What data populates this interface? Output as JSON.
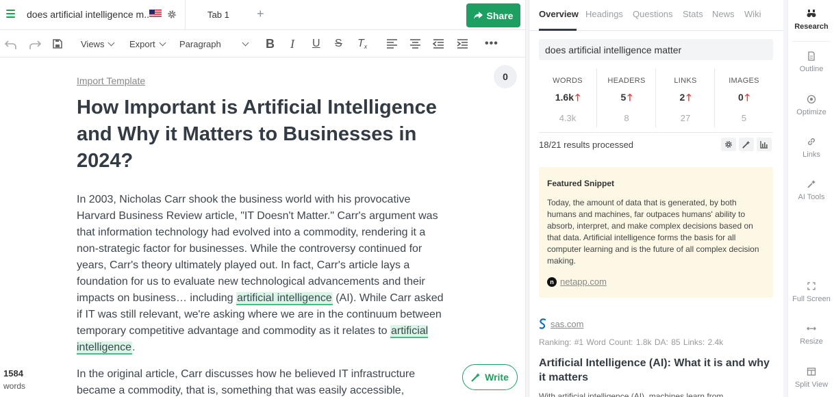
{
  "header": {
    "doc_title": "does artificial intelligence m...",
    "tab_label": "Tab 1",
    "add_tab": "+",
    "share_label": "Share"
  },
  "toolbar": {
    "views_label": "Views",
    "export_label": "Export",
    "block_type": "Paragraph"
  },
  "editor": {
    "import_template": "Import Template",
    "comment_count": "0",
    "heading": "How Important is Artificial Intelligence and Why it Matters to Businesses in 2024?",
    "para1_a": "In 2003, Nicholas Carr shook the business world with his provocative Harvard Business Review article, \"IT Doesn't Matter.\" Carr's argument was that information technology had evolved into a commodity, rendering it a non-strategic factor for businesses. While the controversy continued for years, Carr's theory ultimately played out. In fact, Carr's article lays a foundation for us to evaluate new technological advancements and their impacts on business… including ",
    "para1_hl1": "artificial intelligence",
    "para1_b": " (AI). While Carr asked if IT was still relevant, we're asking where we are in the continuum between temporary competitive advantage and commodity as it relates to ",
    "para1_hl2": "artificial intelligence",
    "para1_c": ".",
    "para2": "In the original article, Carr discusses how he believed IT infrastructure became a commodity, that is, something that was easily accessible,",
    "word_count": "1584",
    "word_label": "words",
    "write_label": "Write"
  },
  "panel": {
    "tabs": [
      "Overview",
      "Headings",
      "Questions",
      "Stats",
      "News",
      "Wiki"
    ],
    "query": "does artificial intelligence matter",
    "stats": [
      {
        "label": "WORDS",
        "value": "1.6k",
        "target": "4.3k"
      },
      {
        "label": "HEADERS",
        "value": "5",
        "target": "8"
      },
      {
        "label": "LINKS",
        "value": "2",
        "target": "27"
      },
      {
        "label": "IMAGES",
        "value": "0",
        "target": "5"
      }
    ],
    "up_arrow": "🡑",
    "processed": "18/21 results processed",
    "snippet": {
      "heading": "Featured Snippet",
      "text": "Today, the amount of data that is generated, by both humans and machines, far outpaces humans' ability to absorb, interpret, and make complex decisions based on that data. Artificial intelligence forms the basis for all computer learning and is the future of all complex decision making.",
      "source": "netapp.com",
      "source_icon": "n"
    },
    "result": {
      "source": "sas.com",
      "ranking": "Ranking: #1  Word Count: 1.8k  DA: 85  Links: 2.4k",
      "title": "Artificial Intelligence (AI): What it is and why it matters",
      "snippet": "With artificial intelligence (AI), machines learn from"
    }
  },
  "rail": {
    "items": [
      {
        "label": "Research",
        "icon": "binoculars-icon"
      },
      {
        "label": "Outline",
        "icon": "document-icon"
      },
      {
        "label": "Optimize",
        "icon": "target-icon"
      },
      {
        "label": "Links",
        "icon": "link-icon"
      },
      {
        "label": "AI Tools",
        "icon": "magic-wand-icon"
      },
      {
        "label": "Full Screen",
        "icon": "fullscreen-icon"
      },
      {
        "label": "Resize",
        "icon": "resize-icon"
      },
      {
        "label": "Split View",
        "icon": "split-view-icon"
      }
    ]
  },
  "colors": {
    "brand_green": "#1e9f62",
    "highlight": "#d8f5e6",
    "arrow_red": "#e03a3a",
    "snippet_bg": "#fdf7e6"
  }
}
